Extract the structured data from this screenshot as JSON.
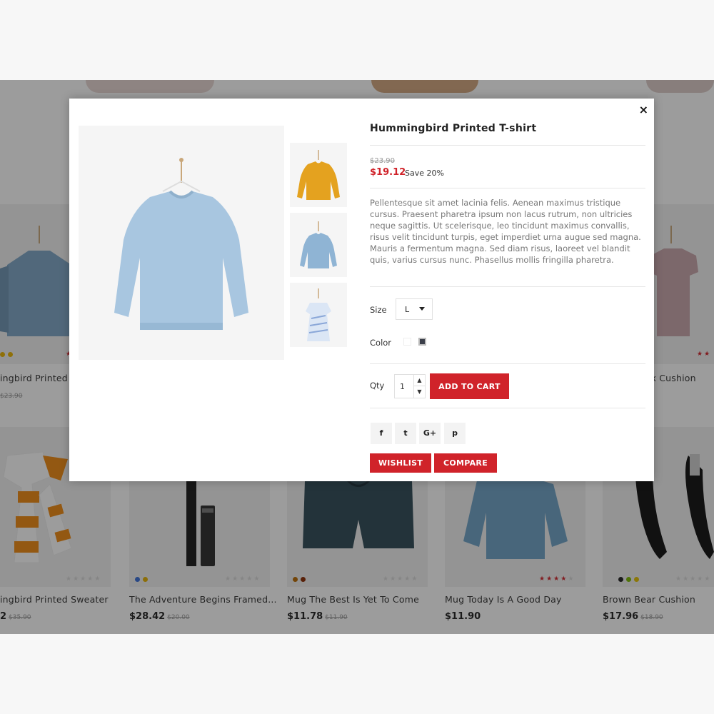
{
  "modal": {
    "title": "Hummingbird Printed T-shirt",
    "old_price": "$23.90",
    "new_price": "$19.12",
    "save_text": "Save 20%",
    "description": "Pellentesque sit amet lacinia felis. Aenean maximus tristique cursus. Praesent pharetra ipsum non lacus rutrum, non ultricies neque sagittis. Ut scelerisque, leo tincidunt maximus convallis, risus velit tincidunt turpis, eget imperdiet urna augue sed magna. Mauris a fermentum magna. Sed diam risus, laoreet vel blandit quis, varius cursus nunc. Phasellus mollis fringilla pharetra.",
    "size_label": "Size",
    "size_value": "L",
    "color_label": "Color",
    "colors": [
      "#ffffff",
      "#3b3f4a"
    ],
    "qty_label": "Qty",
    "qty_value": "1",
    "add_to_cart": "ADD TO CART",
    "wishlist": "WISHLIST",
    "compare": "COMPARE",
    "close": "×",
    "social": [
      "f",
      "t",
      "G+",
      "p"
    ],
    "thumbnails": [
      "mustard-sweater",
      "blue-sweater",
      "striped-dress"
    ],
    "accent_color": "#d0232a"
  },
  "background": {
    "row1": [
      {
        "name": "ingbird Printed",
        "old": "$23.90",
        "dots": [
          "#f0b400",
          "#f0b400"
        ],
        "rating": 1
      },
      {
        "name": "ox Cushion",
        "rating": 2
      }
    ],
    "row2": [
      {
        "name": "ingbird Printed Sweater",
        "price": "2",
        "old": "$35.90",
        "dots": [],
        "rating": 0
      },
      {
        "name": "The Adventure Begins Framed...",
        "price": "$28.42",
        "old": "$20.00",
        "dots": [
          "#3a6fd8",
          "#e3b000"
        ],
        "rating": 0
      },
      {
        "name": "Mug The Best Is Yet To Come",
        "price": "$11.78",
        "old": "$11.90",
        "dots": [
          "#b86a00",
          "#8a2a00"
        ],
        "rating": 0
      },
      {
        "name": "Mug Today Is A Good Day",
        "price": "$11.90",
        "old": "",
        "dots": [],
        "rating": 4
      },
      {
        "name": "Brown Bear Cushion",
        "price": "$17.96",
        "old": "$18.90",
        "dots": [
          "#222222",
          "#7ab800",
          "#e3c000"
        ],
        "rating": 0
      }
    ]
  }
}
